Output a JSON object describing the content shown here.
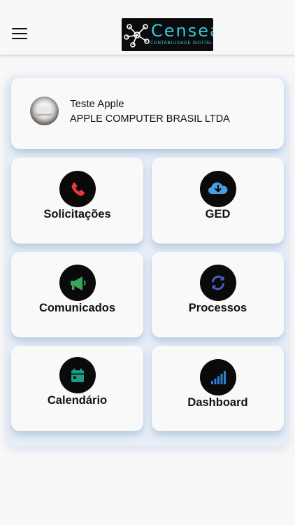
{
  "header": {
    "menu_icon": "hamburger-menu-icon",
    "logo": {
      "word": "Censea",
      "tagline": "CONTABILIDADE DIGITAL"
    }
  },
  "profile": {
    "user_name": "Teste Apple",
    "company_name": "APPLE COMPUTER BRASIL LTDA"
  },
  "tiles": [
    {
      "label": "Solicitações",
      "icon": "phone-icon",
      "color": "#e8363c"
    },
    {
      "label": "GED",
      "icon": "cloud-download-icon",
      "color": "#4a9ee0"
    },
    {
      "label": "Comunicados",
      "icon": "megaphone-icon",
      "color": "#3aa657"
    },
    {
      "label": "Processos",
      "icon": "sync-icon",
      "color": "#4d5cc4"
    },
    {
      "label": "Calendário",
      "icon": "calendar-icon",
      "color": "#1f9c86"
    },
    {
      "label": "Dashboard",
      "icon": "signal-bars-icon",
      "color": "#2f7fd8"
    }
  ]
}
